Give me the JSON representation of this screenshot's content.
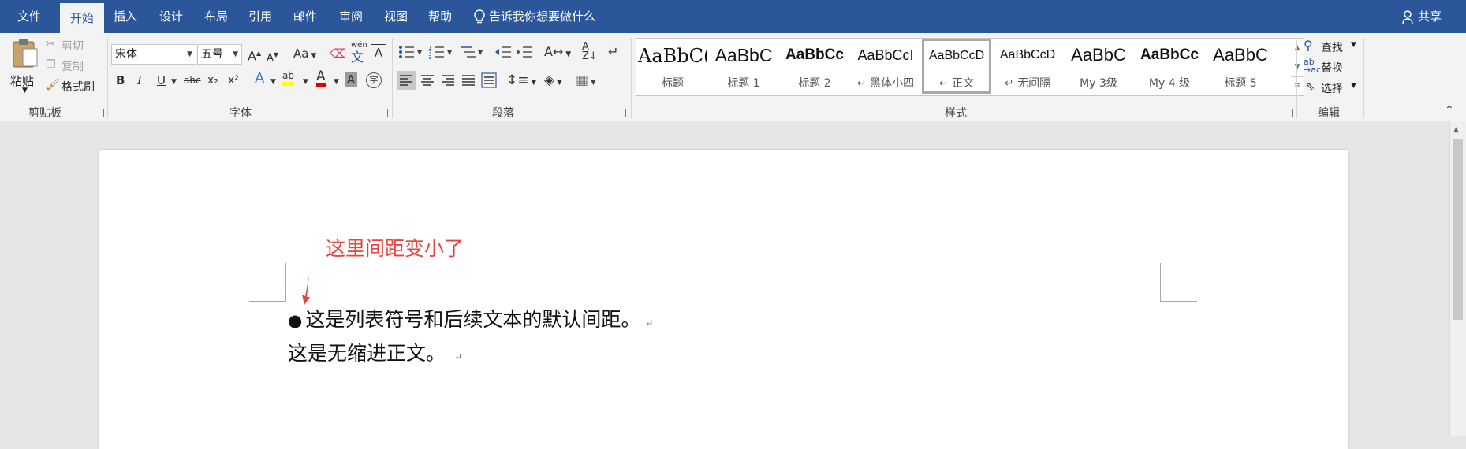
{
  "menu": {
    "tabs": [
      "文件",
      "开始",
      "插入",
      "设计",
      "布局",
      "引用",
      "邮件",
      "审阅",
      "视图",
      "帮助"
    ],
    "tell_me": "告诉我你想要做什么",
    "share": "共享"
  },
  "clipboard": {
    "paste": "粘贴",
    "cut": "剪切",
    "copy": "复制",
    "format_painter": "格式刷",
    "label": "剪贴板"
  },
  "font": {
    "family": "宋体",
    "size": "五号",
    "grow": "A",
    "shrink": "A",
    "change_case": "Aa",
    "phonetic": "wén",
    "phonetic_char": "文",
    "border_char": "A",
    "bold": "B",
    "italic": "I",
    "underline": "U",
    "strike": "abc",
    "subscript": "x₂",
    "superscript": "x²",
    "effects": "A",
    "highlight": "ab",
    "color": "A",
    "shading": "A",
    "enclose": "字",
    "label": "字体"
  },
  "paragraph": {
    "label": "段落"
  },
  "styles": {
    "label": "样式",
    "items": [
      {
        "preview": "AaBbC(",
        "name": "标题"
      },
      {
        "preview": "AaBbC",
        "name": "标题 1"
      },
      {
        "preview": "AaBbCc",
        "name": "标题 2"
      },
      {
        "preview": "AaBbCcI",
        "name": "↵ 黑体小四"
      },
      {
        "preview": "AaBbCcD",
        "name": "↵ 正文"
      },
      {
        "preview": "AaBbCcD",
        "name": "↵ 无间隔"
      },
      {
        "preview": "AaBbC",
        "name": "My 3级"
      },
      {
        "preview": "AaBbCc",
        "name": "My 4 级"
      },
      {
        "preview": "AaBbC",
        "name": "标题 5"
      }
    ]
  },
  "editing": {
    "find": "查找",
    "replace": "替换",
    "select": "选择",
    "label": "编辑"
  },
  "document": {
    "annotation": "这里间距变小了",
    "bullet": "●",
    "line1": "这是列表符号和后续文本的默认间距。",
    "line2": "这是无缩进正文。",
    "para_mark": "↵"
  },
  "colors": {
    "brand": "#2b579a",
    "annotation": "#e8433c",
    "highlight": "#ffff00",
    "font_color": "#e00000"
  }
}
